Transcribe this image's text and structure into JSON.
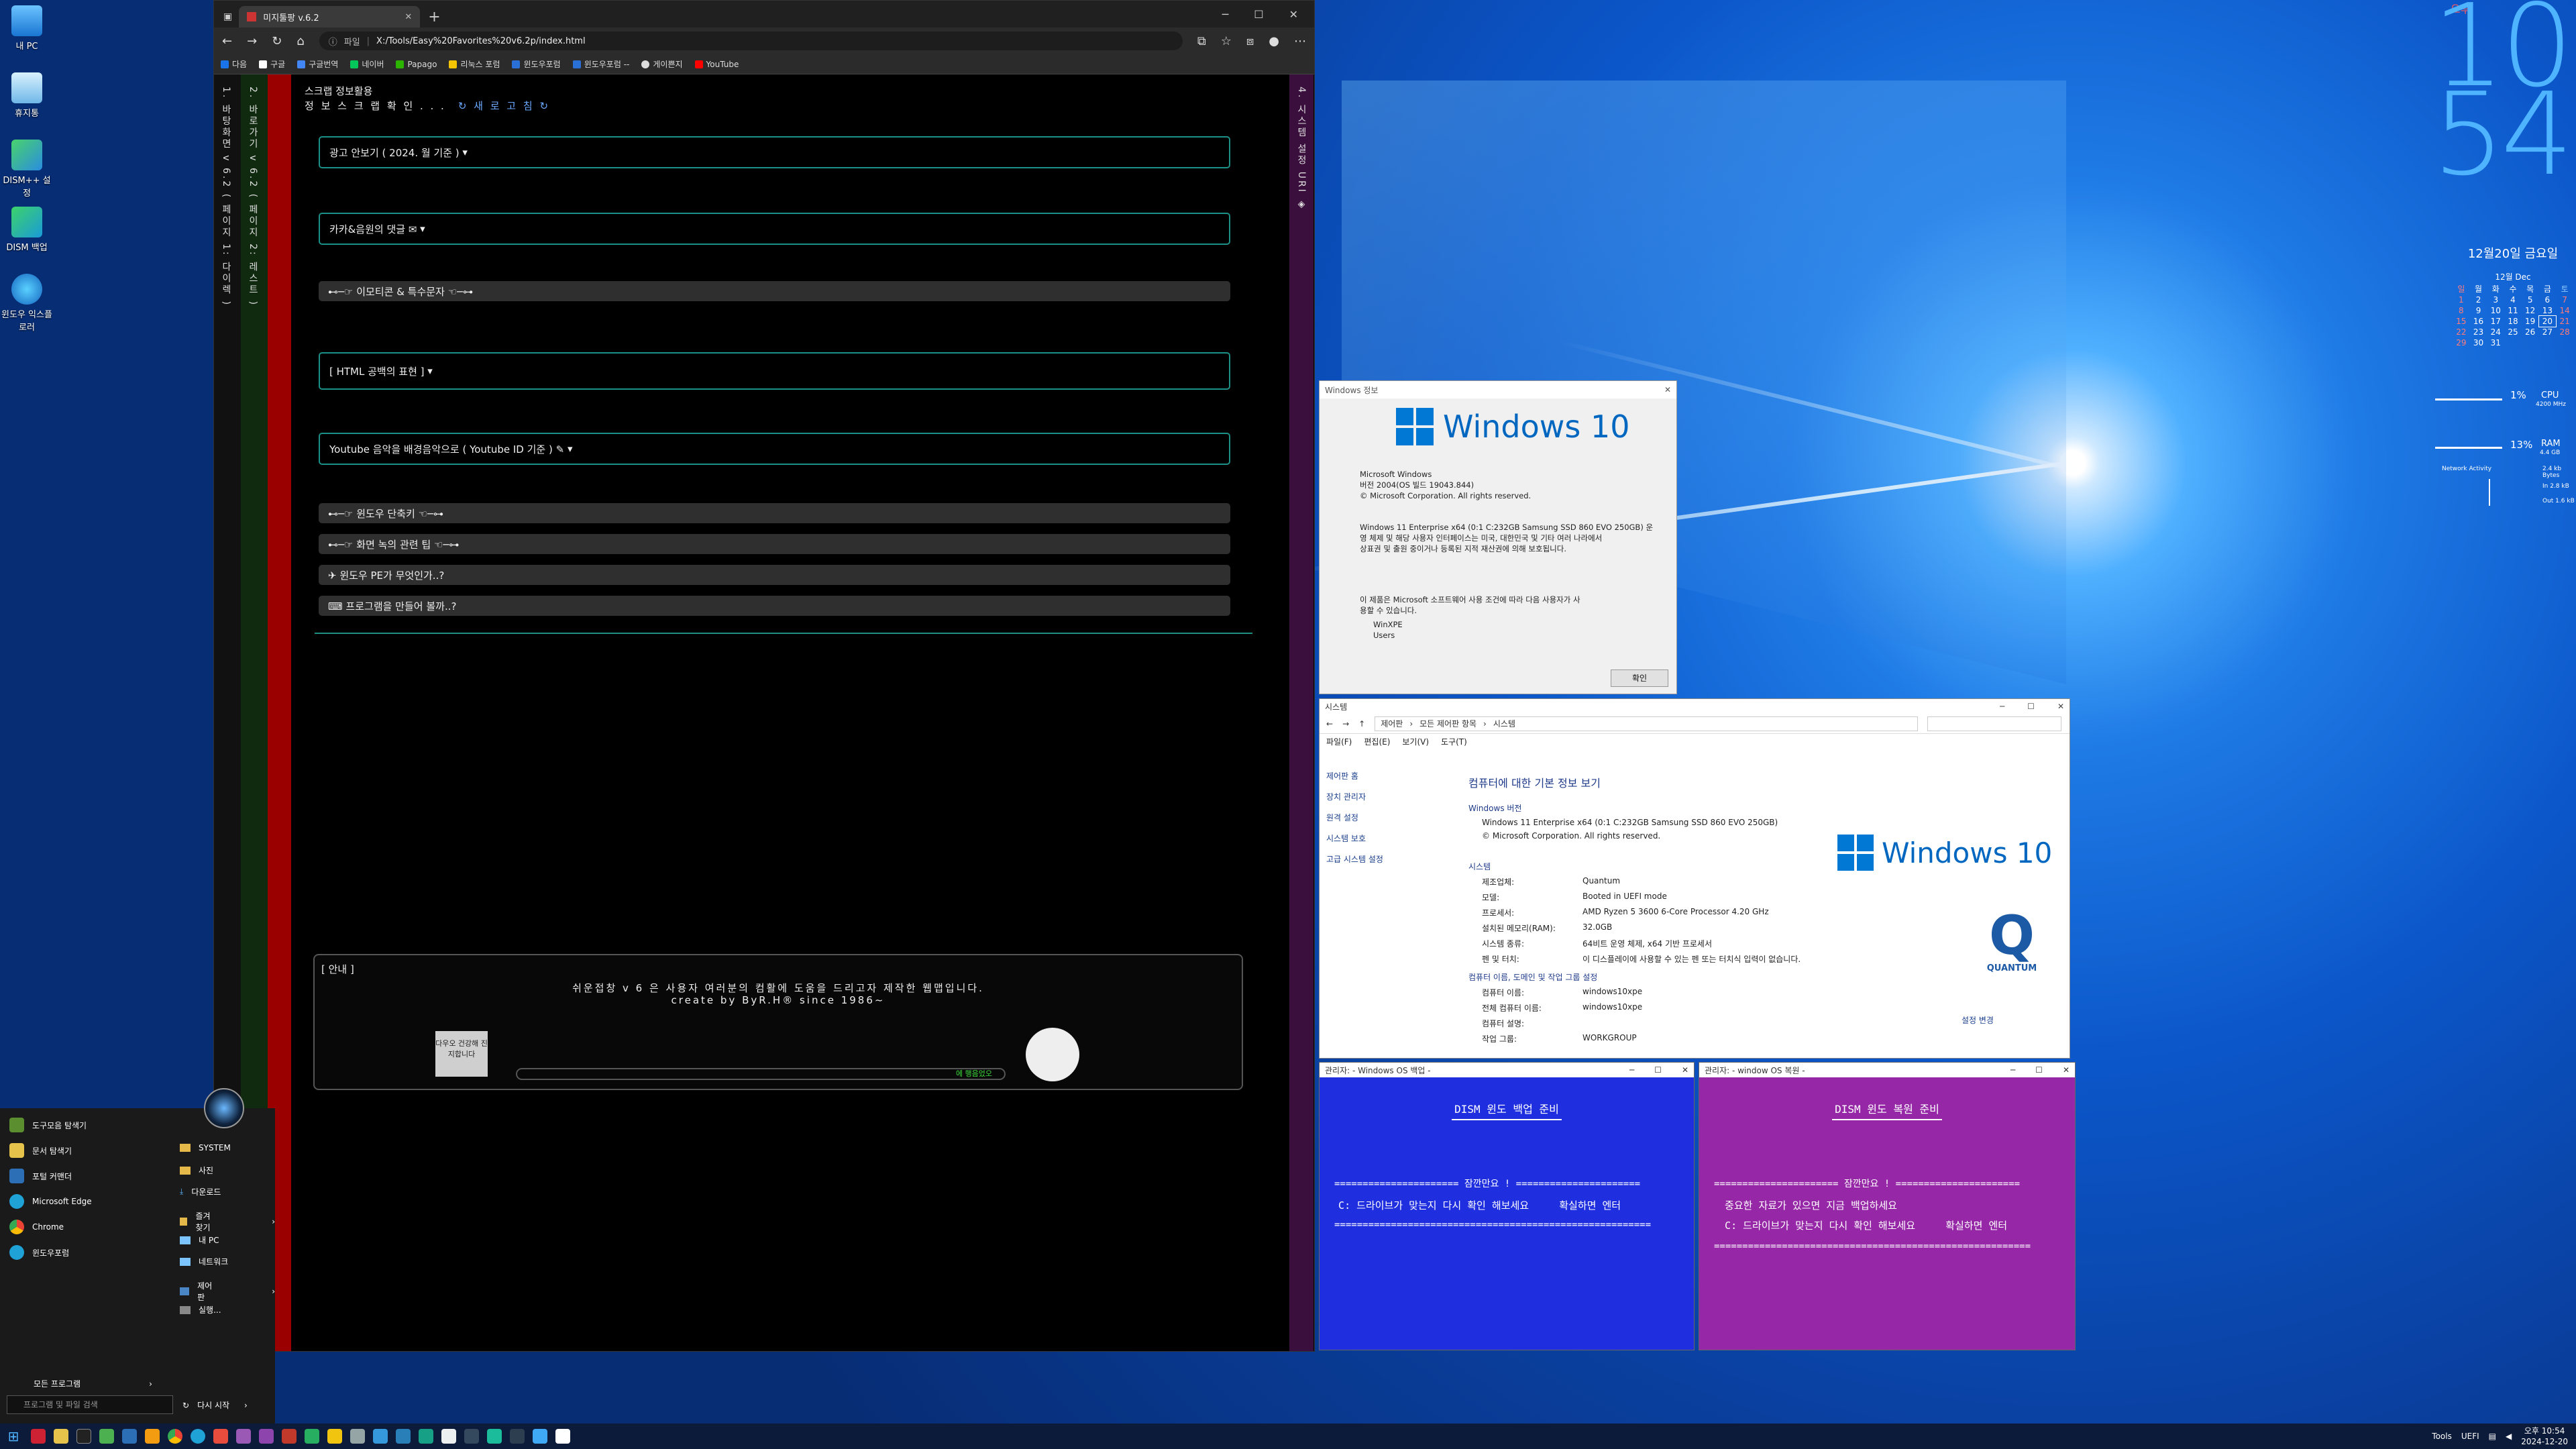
{
  "desktop": {
    "icons": [
      "내 PC",
      "휴지통",
      "DISM++ 설정",
      "DISM 백업",
      "윈도우 익스플로러"
    ]
  },
  "browser": {
    "tab_title": "미지툴팡 v.6.2",
    "address_chip": "파일",
    "url": "X:/Tools/Easy%20Favorites%20v6.2p/index.html",
    "bookmarks": [
      "다음",
      "구글",
      "구글번역",
      "네이버",
      "Papago",
      "리눅스 포럼",
      "윈도우포럼",
      "윈도우포럼 --",
      "게이쁜지",
      "YouTube"
    ],
    "side_tabs": [
      "1. 바탕화면 v 6.2 ( 페이지 1: 다이렉 )",
      "2. 바로가기 v 6.2 ( 페이지 2: 레스트 )"
    ],
    "right_tab": "4. 시스템 설정 URI ◈",
    "header_title": "스크랩 정보활용",
    "header_sub": "정 보 스 크 랩 확 인 . . .",
    "header_refresh": "새 로 고 침",
    "accordions": [
      "광고 안보기 ( 2024. 월 기준 )",
      "카카&음원의 댓글 ✉",
      "⊷─☞ 이모티콘 & 특수문자 ☜─⊶",
      "[ HTML 공백의 표현 ]",
      "Youtube 음악을 배경음악으로 ( Youtube ID 기준 ) ✎",
      "⊷─☞ 윈도우 단축키 ☜─⊶",
      "⊷─☞ 화면 녹의 관련 팁 ☜─⊶",
      "✈ 윈도우 PE가 무엇인가..?",
      "⌨ 프로그램을 만들어 볼까..?"
    ],
    "notice": {
      "title": "[ 안내 ]",
      "line1": "쉬운접창 v 6 은 사용자 여러분의 컴활에 도움을 드리고자 제작한 웹맵입니다.",
      "line2": "create by ByR.H® since 1986~",
      "stamp": "다우오 건강해 진지합니다",
      "progress": "에 행음었오"
    }
  },
  "about": {
    "title": "Windows 정보",
    "logo": "Windows 10",
    "lines": [
      "Microsoft Windows",
      "버전 2004(OS 빌드 19043.844)",
      "© Microsoft Corporation. All rights reserved."
    ],
    "desc": [
      "Windows 11 Enterprise x64 (0:1 C:232GB Samsung SSD 860 EVO 250GB) 운",
      "영 체제 및 해당 사용자 인터페이스는 미국, 대한민국 및 기타 여러 나라에서",
      "상표권 및 출원 중이거나 등록된 지적 재산권에 의해 보호됩니다."
    ],
    "license": [
      "이 제품은 Microsoft 소프트웨어 사용 조건에 따라 다음 사용자가 사",
      "용할 수 있습니다."
    ],
    "users": [
      "WinXPE",
      "Users"
    ],
    "ok": "확인"
  },
  "system": {
    "title": "시스템",
    "crumb": [
      "제어판",
      "모든 제어판 항목",
      "시스템"
    ],
    "menu": [
      "파일(F)",
      "편집(E)",
      "보기(V)",
      "도구(T)"
    ],
    "left": [
      "제어판 홈",
      "장치 관리자",
      "원격 설정",
      "시스템 보호",
      "고급 시스템 설정"
    ],
    "heading": "컴퓨터에 대한 기본 정보 보기",
    "edition_label": "Windows 버전",
    "edition": [
      "Windows 11 Enterprise x64 (0:1 C:232GB Samsung SSD 860 EVO 250GB)",
      "© Microsoft Corporation. All rights reserved."
    ],
    "logo": "Windows 10",
    "section_system": "시스템",
    "rows": [
      [
        "제조업체:",
        "Quantum"
      ],
      [
        "모델:",
        "Booted in UEFI mode"
      ],
      [
        "프로세서:",
        "AMD Ryzen 5 3600 6-Core Processor          4.20 GHz"
      ],
      [
        "설치된 메모리(RAM):",
        "32.0GB"
      ],
      [
        "시스템 종류:",
        "64비트 운영 체제, x64 기반 프로세서"
      ],
      [
        "펜 및 터치:",
        "이 디스플레이에 사용할 수 있는 펜 또는 터치식 입력이 없습니다."
      ]
    ],
    "section_name": "컴퓨터 이름, 도메인 및 작업 그룹 설정",
    "rows2": [
      [
        "컴퓨터 이름:",
        "windows10xpe"
      ],
      [
        "전체 컴퓨터 이름:",
        "windows10xpe"
      ],
      [
        "컴퓨터 설명:",
        ""
      ],
      [
        "작업 그룹:",
        "WORKGROUP"
      ]
    ],
    "change": "설정 변경",
    "quantum": "QUANTUM"
  },
  "cmd1": {
    "title": "관리자:       - Windows OS 백업 -",
    "heading": "DISM 윈도 백업 준비",
    "lines": [
      "====================== 잠깐만요 ! ======================",
      "  C: 드라이브가 맞는지 다시 확인 해보세요     확실하면 엔터",
      "========================================================"
    ]
  },
  "cmd2": {
    "title": "관리자:       - window OS 복원 -",
    "heading": "DISM 윈도 복원 준비",
    "lines": [
      "====================== 잠깐만요 ! ======================",
      "  중요한 자료가 있으면 지금 백업하세요",
      "  C: 드라이브가 맞는지 다시 확인 해보세요     확실하면 엔터",
      "========================================================"
    ]
  },
  "clock": {
    "ampm": "오후",
    "hour": "10",
    "minute": "54",
    "date": "12월20일 금요일",
    "month": "12월 Dec"
  },
  "calendar": {
    "head": [
      "일",
      "월",
      "화",
      "수",
      "목",
      "금",
      "토"
    ],
    "weeks": [
      [
        "1",
        "2",
        "3",
        "4",
        "5",
        "6",
        "7"
      ],
      [
        "8",
        "9",
        "10",
        "11",
        "12",
        "13",
        "14"
      ],
      [
        "15",
        "16",
        "17",
        "18",
        "19",
        "20",
        "21"
      ],
      [
        "22",
        "23",
        "24",
        "25",
        "26",
        "27",
        "28"
      ],
      [
        "29",
        "30",
        "31",
        "",
        "",
        "",
        ""
      ]
    ]
  },
  "meters": {
    "cpu_pct": "1%",
    "cpu": "CPU",
    "cpu_sub": "4200 MHz",
    "ram_pct": "13%",
    "ram": "RAM",
    "ram_sub": "4.4 GB",
    "net": "Network Activity",
    "net_in": "In 2.8 kB",
    "net_out": "Out 1.6 kB",
    "net_sub": "2.4 kb Bytes"
  },
  "startmenu": {
    "left": [
      "도구모음 탐색기",
      "문서 탐색기",
      "포털 커맨더",
      "Microsoft Edge",
      "Chrome",
      "윈도우포럼"
    ],
    "right": [
      "SYSTEM",
      "사진",
      "다운로드",
      "즐겨찾기",
      "내 PC",
      "네트워크",
      "제어판",
      "실행..."
    ],
    "all": "모든 프로그램",
    "restart": "다시 시작",
    "search": "프로그램 및 파일 검색"
  },
  "taskbar": {
    "tools": "Tools",
    "lang": "UEFI",
    "time": "오후 10:54",
    "date": "2024-12-20"
  }
}
